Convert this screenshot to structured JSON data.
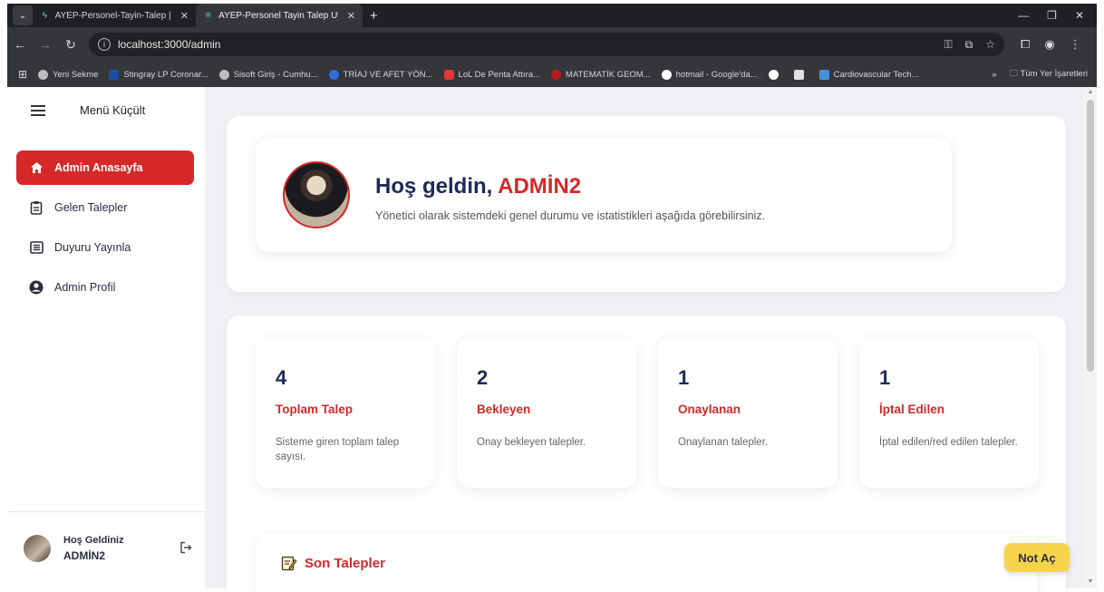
{
  "browser": {
    "tabs": [
      {
        "label": "AYEP-Personel-Tayin-Talep | ker",
        "active": false
      },
      {
        "label": "AYEP-Personel Tayin Talep Uyg",
        "active": true
      }
    ],
    "new_tab": "+",
    "url": "localhost:3000/admin",
    "bookmarks": [
      {
        "label": "Yeni Sekme",
        "color": "#bdbdbd"
      },
      {
        "label": "Stingray LP Coronar...",
        "color": "#1a4fa3"
      },
      {
        "label": "Sisoft Giriş - Cumhu...",
        "color": "#bdbdbd"
      },
      {
        "label": "TRİAJ VE AFET YÖN...",
        "color": "#2f6fd6"
      },
      {
        "label": "LoL De Penta Attıra...",
        "color": "#e53935"
      },
      {
        "label": "MATEMATİK GEOM...",
        "color": "#b71c1c"
      },
      {
        "label": "hotmail - Google'da...",
        "color": "#ffffff"
      },
      {
        "label": "Cardiovascular Tech...",
        "color": "#4a90d9"
      }
    ],
    "bookmarks_more": "»",
    "all_bookmarks": "Tüm Yer İşaretleri"
  },
  "sidebar": {
    "toggle_label": "Menü Küçült",
    "items": [
      {
        "label": "Admin Anasayfa",
        "active": true,
        "icon": "home-icon"
      },
      {
        "label": "Gelen Talepler",
        "active": false,
        "icon": "clipboard-icon"
      },
      {
        "label": "Duyuru Yayınla",
        "active": false,
        "icon": "list-icon"
      },
      {
        "label": "Admin Profil",
        "active": false,
        "icon": "user-circle-icon"
      }
    ],
    "user": {
      "greeting": "Hoş Geldiniz",
      "name": "ADMİN2"
    }
  },
  "welcome": {
    "title_prefix": "Hoş geldin, ",
    "name": "ADMİN2",
    "subtitle": "Yönetici olarak sistemdeki genel durumu ve istatistikleri aşağıda görebilirsiniz."
  },
  "stats": [
    {
      "value": "4",
      "title": "Toplam Talep",
      "desc": "Sisteme giren toplam talep sayısı."
    },
    {
      "value": "2",
      "title": "Bekleyen",
      "desc": "Onay bekleyen talepler."
    },
    {
      "value": "1",
      "title": "Onaylanan",
      "desc": "Onaylanan talepler."
    },
    {
      "value": "1",
      "title": "İptal Edilen",
      "desc": "İptal edilen/red edilen talepler."
    }
  ],
  "recent": {
    "title": "Son Talepler"
  },
  "note_button": "Not Aç",
  "colors": {
    "accent": "#d62828",
    "navy": "#1d2a57",
    "note": "#f8d44c"
  }
}
